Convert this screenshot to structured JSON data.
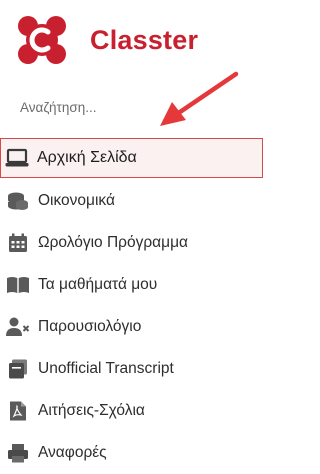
{
  "brand": {
    "name": "Classter",
    "color": "#c8202f",
    "icon": "classter-logo-icon"
  },
  "search": {
    "placeholder": "Αναζήτηση..."
  },
  "annotation": {
    "arrow_color": "#e5383b",
    "highlight_color": "#d44a4a"
  },
  "sidebar": {
    "items": [
      {
        "label": "Αρχική Σελίδα",
        "icon": "laptop-icon",
        "active": true
      },
      {
        "label": "Οικονομικά",
        "icon": "coins-icon"
      },
      {
        "label": "Ωρολόγιο Πρόγραμμα",
        "icon": "calendar-icon"
      },
      {
        "label": "Τα μαθήματά μου",
        "icon": "book-icon"
      },
      {
        "label": "Παρουσιολόγιο",
        "icon": "user-times-icon"
      },
      {
        "label": "Unofficial Transcript",
        "icon": "document-icon"
      },
      {
        "label": "Αιτήσεις-Σχόλια",
        "icon": "pdf-file-icon"
      },
      {
        "label": "Αναφορές",
        "icon": "printer-icon"
      }
    ]
  }
}
